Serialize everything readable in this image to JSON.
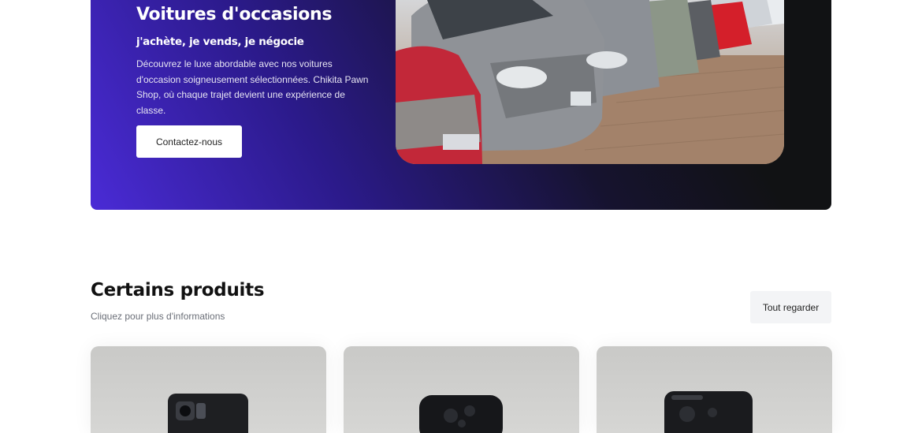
{
  "hero": {
    "title": "Voitures d'occasions",
    "subtitle": "j'achète, je vends, je négocie",
    "description": "Découvrez le luxe abordable avec nos voitures d'occasion soigneusement sélectionnées. Chikita Pawn Shop, où chaque trajet devient une expérience de classe.",
    "cta_label": "Contactez-nous"
  },
  "products": {
    "title": "Certains produits",
    "subtitle": "Cliquez pour plus d'informations",
    "see_all_label": "Tout regarder",
    "items": [
      {
        "image": "phone-photo"
      },
      {
        "image": "phone-photo"
      },
      {
        "image": "phone-photo"
      }
    ]
  },
  "colors": {
    "hero_gradient_start": "#4a2bd6",
    "hero_gradient_end": "#111214",
    "button_bg": "#ffffff",
    "see_all_bg": "#f3f4f6",
    "subtitle_text": "#6b6f78"
  }
}
